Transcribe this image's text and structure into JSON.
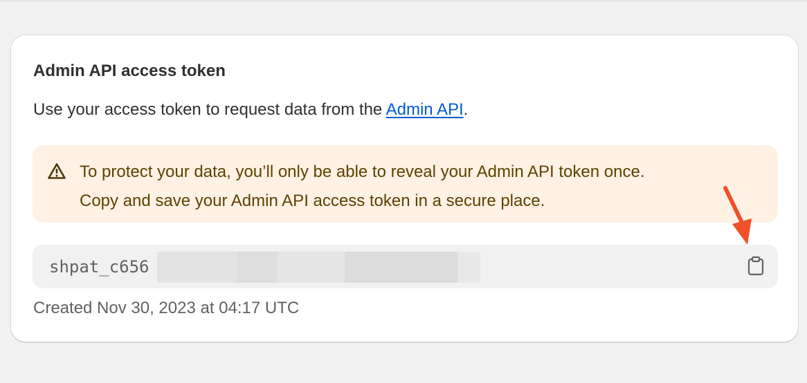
{
  "card": {
    "title": "Admin API access token",
    "description_prefix": "Use your access token to request data from the ",
    "description_link": "Admin API",
    "description_suffix": "."
  },
  "banner": {
    "line1": "To protect your data, you’ll only be able to reveal your Admin API token once.",
    "line2": "Copy and save your Admin API access token in a secure place.",
    "icon": "warning-triangle-icon"
  },
  "token": {
    "visible_value": "shpat_c656",
    "copy_icon": "clipboard-icon"
  },
  "created": "Created Nov 30, 2023 at 04:17 UTC",
  "colors": {
    "page_background": "#f1f1f1",
    "card_background": "#ffffff",
    "link": "#005bd3",
    "banner_background": "#fff1e3",
    "banner_text": "#5e4200",
    "token_field_background": "#f1f1f1",
    "annotation_arrow": "#f0502a"
  }
}
